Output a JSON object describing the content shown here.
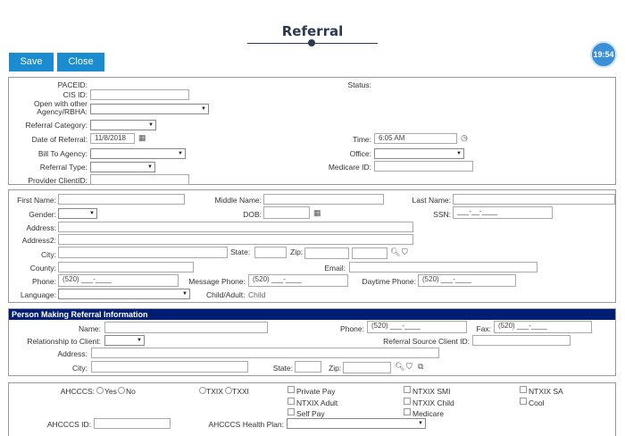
{
  "header": {
    "title": "Referral",
    "timer": "19:54"
  },
  "toolbar": {
    "save_label": "Save",
    "close_label": "Close"
  },
  "referral": {
    "paceid_label": "PACEID:",
    "status_label": "Status:",
    "cis_id_label": "CIS ID:",
    "open_with_label": "Open with other Agency/RBHA:",
    "category_label": "Referral Category:",
    "date_label": "Date of Referral:",
    "date_value": "11/8/2018",
    "time_label": "Time:",
    "time_value": "6:05 AM",
    "bill_to_label": "Bill To Agency:",
    "office_label": "Office:",
    "type_label": "Referral Type:",
    "medicare_label": "Medicare ID:",
    "provider_label": "Provider ClientID:"
  },
  "person": {
    "first_name_label": "First Name:",
    "middle_name_label": "Middle Name:",
    "last_name_label": "Last Name:",
    "gender_label": "Gender:",
    "dob_label": "DOB:",
    "ssn_label": "SSN:",
    "ssn_value": "___-__-____",
    "address_label": "Address:",
    "address2_label": "Address2:",
    "city_label": "City:",
    "state_label": "State:",
    "zip_label": "Zip:",
    "county_label": "County:",
    "email_label": "Email:",
    "phone_label": "Phone:",
    "phone_value": "(520) ___-____",
    "message_phone_label": "Message Phone:",
    "message_phone_value": "(520) ___-____",
    "daytime_phone_label": "Daytime Phone:",
    "daytime_phone_value": "(520) ___-____",
    "language_label": "Language:",
    "child_adult_label": "Child/Adult:",
    "child_adult_value": "Child"
  },
  "referrer": {
    "section_title": "Person Making Referral Information",
    "name_label": "Name:",
    "phone_label": "Phone:",
    "phone_value": "(520) ___-____",
    "fax_label": "Fax:",
    "fax_value": "(520) ___-____",
    "relationship_label": "Relationship to Client:",
    "source_id_label": "Referral Source Client ID:",
    "address_label": "Address:",
    "city_label": "City:",
    "state_label": "State:",
    "zip_label": "Zip:"
  },
  "coverage": {
    "ahcccs_label": "AHCCCS:",
    "yes_label": "Yes",
    "no_label": "No",
    "txix_label": "TXIX",
    "txxi_label": "TXXI",
    "private_pay_label": "Private Pay",
    "ntxix_smi_label": "NTXIX SMI",
    "ntxix_sa_label": "NTXIX SA",
    "ntxix_adult_label": "NTXIX Adult",
    "ntxix_child_label": "NTXIX Child",
    "cool_label": "Cool",
    "self_pay_label": "Self Pay",
    "medicare_label": "Medicare",
    "ahcccs_id_label": "AHCCCS ID:",
    "health_plan_label": "AHCCCS Health Plan:"
  }
}
